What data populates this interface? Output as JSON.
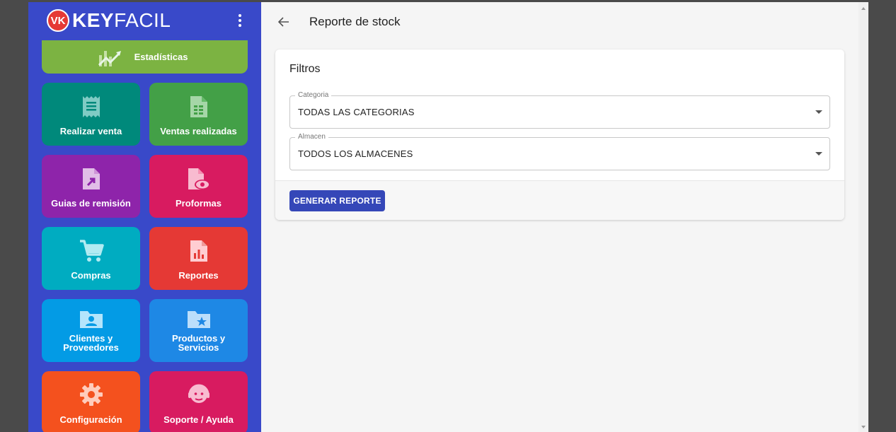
{
  "app": {
    "brand_badge": "VK",
    "brand_bold": "KEY",
    "brand_light": "FACIL"
  },
  "sidebar": {
    "top_tile": {
      "label": "Estadísticas",
      "color": "#7cb342",
      "icon": "trend-chart-icon"
    },
    "tiles": [
      {
        "label": "Realizar venta",
        "color": "#00897b",
        "icon": "receipt-icon"
      },
      {
        "label": "Ventas realizadas",
        "color": "#43a047",
        "icon": "spreadsheet-file-icon"
      },
      {
        "label": "Guias de remisión",
        "color": "#8e24aa",
        "icon": "file-arrow-icon"
      },
      {
        "label": "Proformas",
        "color": "#d81b60",
        "icon": "file-eye-icon"
      },
      {
        "label": "Compras",
        "color": "#00acc1",
        "icon": "cart-icon"
      },
      {
        "label": "Reportes",
        "color": "#e53935",
        "icon": "report-file-icon"
      },
      {
        "label": "Clientes y Proveedores",
        "color": "#039be5",
        "icon": "folder-person-icon"
      },
      {
        "label": "Productos y Servicios",
        "color": "#1e88e5",
        "icon": "folder-star-icon"
      },
      {
        "label": "Configuración",
        "color": "#f4511e",
        "icon": "gear-icon"
      },
      {
        "label": "Soporte / Ayuda",
        "color": "#d81b60",
        "icon": "support-agent-icon"
      }
    ]
  },
  "header": {
    "title": "Reporte de stock"
  },
  "filters": {
    "title": "Filtros",
    "category_label": "Categoria",
    "category_value": "TODAS LAS CATEGORIAS",
    "warehouse_label": "Almacen",
    "warehouse_value": "TODOS LOS ALMACENES",
    "generate_label": "GENERAR REPORTE"
  }
}
